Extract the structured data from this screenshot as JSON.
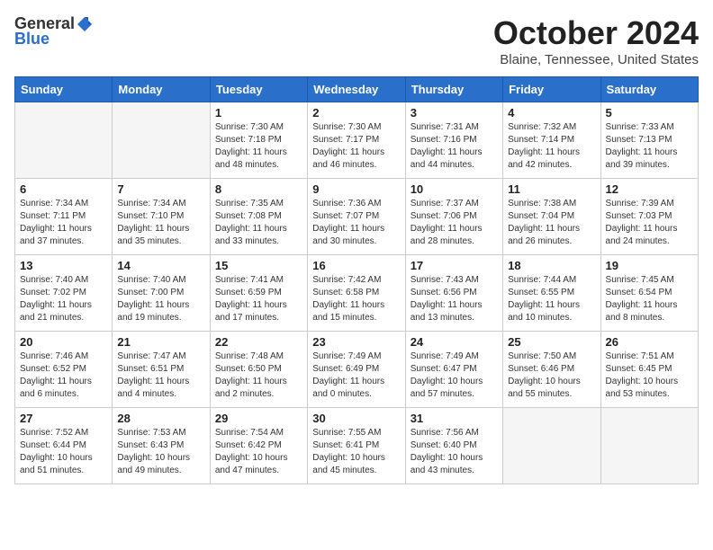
{
  "header": {
    "logo_general": "General",
    "logo_blue": "Blue",
    "title": "October 2024",
    "subtitle": "Blaine, Tennessee, United States"
  },
  "days_of_week": [
    "Sunday",
    "Monday",
    "Tuesday",
    "Wednesday",
    "Thursday",
    "Friday",
    "Saturday"
  ],
  "weeks": [
    [
      {
        "day": "",
        "info": ""
      },
      {
        "day": "",
        "info": ""
      },
      {
        "day": "1",
        "info": "Sunrise: 7:30 AM\nSunset: 7:18 PM\nDaylight: 11 hours\nand 48 minutes."
      },
      {
        "day": "2",
        "info": "Sunrise: 7:30 AM\nSunset: 7:17 PM\nDaylight: 11 hours\nand 46 minutes."
      },
      {
        "day": "3",
        "info": "Sunrise: 7:31 AM\nSunset: 7:16 PM\nDaylight: 11 hours\nand 44 minutes."
      },
      {
        "day": "4",
        "info": "Sunrise: 7:32 AM\nSunset: 7:14 PM\nDaylight: 11 hours\nand 42 minutes."
      },
      {
        "day": "5",
        "info": "Sunrise: 7:33 AM\nSunset: 7:13 PM\nDaylight: 11 hours\nand 39 minutes."
      }
    ],
    [
      {
        "day": "6",
        "info": "Sunrise: 7:34 AM\nSunset: 7:11 PM\nDaylight: 11 hours\nand 37 minutes."
      },
      {
        "day": "7",
        "info": "Sunrise: 7:34 AM\nSunset: 7:10 PM\nDaylight: 11 hours\nand 35 minutes."
      },
      {
        "day": "8",
        "info": "Sunrise: 7:35 AM\nSunset: 7:08 PM\nDaylight: 11 hours\nand 33 minutes."
      },
      {
        "day": "9",
        "info": "Sunrise: 7:36 AM\nSunset: 7:07 PM\nDaylight: 11 hours\nand 30 minutes."
      },
      {
        "day": "10",
        "info": "Sunrise: 7:37 AM\nSunset: 7:06 PM\nDaylight: 11 hours\nand 28 minutes."
      },
      {
        "day": "11",
        "info": "Sunrise: 7:38 AM\nSunset: 7:04 PM\nDaylight: 11 hours\nand 26 minutes."
      },
      {
        "day": "12",
        "info": "Sunrise: 7:39 AM\nSunset: 7:03 PM\nDaylight: 11 hours\nand 24 minutes."
      }
    ],
    [
      {
        "day": "13",
        "info": "Sunrise: 7:40 AM\nSunset: 7:02 PM\nDaylight: 11 hours\nand 21 minutes."
      },
      {
        "day": "14",
        "info": "Sunrise: 7:40 AM\nSunset: 7:00 PM\nDaylight: 11 hours\nand 19 minutes."
      },
      {
        "day": "15",
        "info": "Sunrise: 7:41 AM\nSunset: 6:59 PM\nDaylight: 11 hours\nand 17 minutes."
      },
      {
        "day": "16",
        "info": "Sunrise: 7:42 AM\nSunset: 6:58 PM\nDaylight: 11 hours\nand 15 minutes."
      },
      {
        "day": "17",
        "info": "Sunrise: 7:43 AM\nSunset: 6:56 PM\nDaylight: 11 hours\nand 13 minutes."
      },
      {
        "day": "18",
        "info": "Sunrise: 7:44 AM\nSunset: 6:55 PM\nDaylight: 11 hours\nand 10 minutes."
      },
      {
        "day": "19",
        "info": "Sunrise: 7:45 AM\nSunset: 6:54 PM\nDaylight: 11 hours\nand 8 minutes."
      }
    ],
    [
      {
        "day": "20",
        "info": "Sunrise: 7:46 AM\nSunset: 6:52 PM\nDaylight: 11 hours\nand 6 minutes."
      },
      {
        "day": "21",
        "info": "Sunrise: 7:47 AM\nSunset: 6:51 PM\nDaylight: 11 hours\nand 4 minutes."
      },
      {
        "day": "22",
        "info": "Sunrise: 7:48 AM\nSunset: 6:50 PM\nDaylight: 11 hours\nand 2 minutes."
      },
      {
        "day": "23",
        "info": "Sunrise: 7:49 AM\nSunset: 6:49 PM\nDaylight: 11 hours\nand 0 minutes."
      },
      {
        "day": "24",
        "info": "Sunrise: 7:49 AM\nSunset: 6:47 PM\nDaylight: 10 hours\nand 57 minutes."
      },
      {
        "day": "25",
        "info": "Sunrise: 7:50 AM\nSunset: 6:46 PM\nDaylight: 10 hours\nand 55 minutes."
      },
      {
        "day": "26",
        "info": "Sunrise: 7:51 AM\nSunset: 6:45 PM\nDaylight: 10 hours\nand 53 minutes."
      }
    ],
    [
      {
        "day": "27",
        "info": "Sunrise: 7:52 AM\nSunset: 6:44 PM\nDaylight: 10 hours\nand 51 minutes."
      },
      {
        "day": "28",
        "info": "Sunrise: 7:53 AM\nSunset: 6:43 PM\nDaylight: 10 hours\nand 49 minutes."
      },
      {
        "day": "29",
        "info": "Sunrise: 7:54 AM\nSunset: 6:42 PM\nDaylight: 10 hours\nand 47 minutes."
      },
      {
        "day": "30",
        "info": "Sunrise: 7:55 AM\nSunset: 6:41 PM\nDaylight: 10 hours\nand 45 minutes."
      },
      {
        "day": "31",
        "info": "Sunrise: 7:56 AM\nSunset: 6:40 PM\nDaylight: 10 hours\nand 43 minutes."
      },
      {
        "day": "",
        "info": ""
      },
      {
        "day": "",
        "info": ""
      }
    ]
  ]
}
